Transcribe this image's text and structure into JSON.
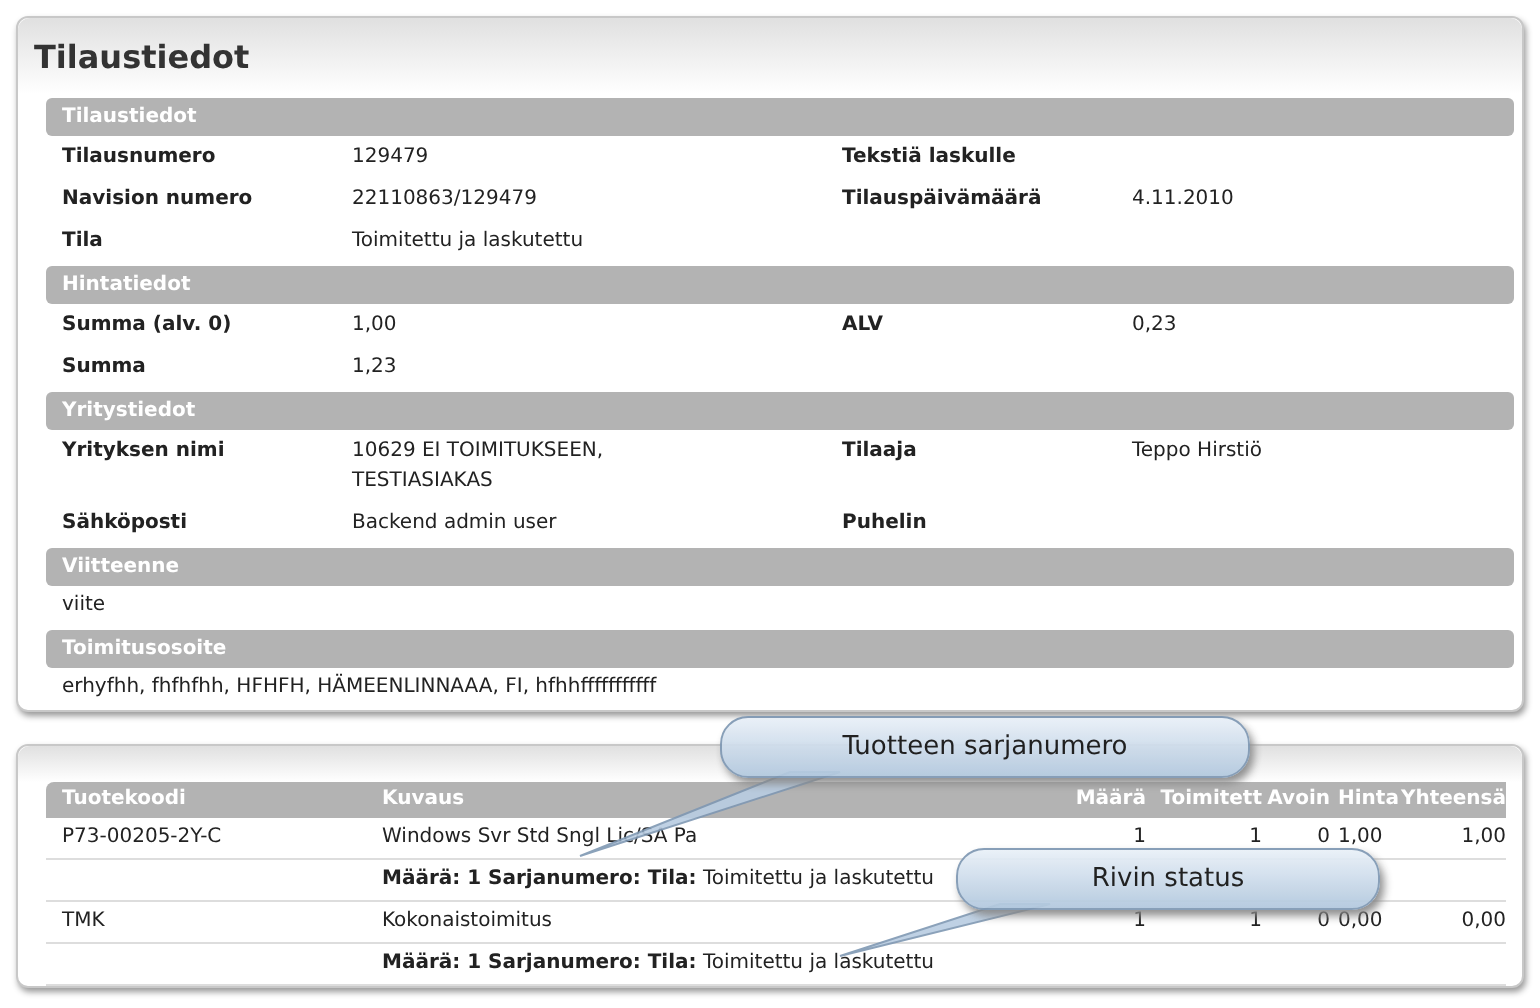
{
  "page_title": "Tilaustiedot",
  "sections": [
    {
      "title": "Tilaustiedot",
      "kind": "fields",
      "rows": [
        [
          {
            "label": "Tilausnumero",
            "value": "129479"
          },
          {
            "label": "Tekstiä laskulle"
          }
        ],
        [
          {
            "label": "Navision numero",
            "value": "22110863/129479"
          },
          {
            "label": "Tilauspäivämäärä",
            "value": "4.11.2010"
          }
        ],
        [
          {
            "label": "Tila",
            "value": "Toimitettu ja laskutettu"
          }
        ]
      ]
    },
    {
      "title": "Hintatiedot",
      "kind": "fields",
      "rows": [
        [
          {
            "label": "Summa (alv. 0)",
            "value": "1,00"
          },
          {
            "label": "ALV",
            "value": "0,23"
          }
        ],
        [
          {
            "label": "Summa",
            "value": "1,23"
          }
        ]
      ]
    },
    {
      "title": "Yritystiedot",
      "kind": "fields",
      "rows": [
        [
          {
            "label": "Yrityksen nimi",
            "value": "10629 EI TOIMITUKSEEN, TESTIASIAKAS"
          },
          {
            "label": "Tilaaja",
            "value": "Teppo Hirstiö"
          }
        ],
        [
          {
            "label": "Sähköposti",
            "value": "Backend admin user"
          },
          {
            "label": "Puhelin"
          }
        ]
      ]
    },
    {
      "title": "Viitteenne",
      "kind": "text",
      "text": "viite"
    },
    {
      "title": "Toimitusosoite",
      "kind": "text",
      "text": "erhyfhh, fhfhfhh, HFHFH, HÄMEENLINNAAA, FI, hfhhfffffffffff"
    }
  ],
  "order_lines": {
    "columns": [
      "Tuotekoodi",
      "Kuvaus",
      "Määrä",
      "Toimitett",
      "Avoin",
      "Hinta",
      "Yhteensä"
    ],
    "rows": [
      {
        "cells": [
          "P73-00205-2Y-C",
          "Windows Svr Std Sngl Lic/SA Pa",
          "1",
          "1",
          "0",
          "1,00",
          "1,00"
        ],
        "detail": "**Määrä: 1 Sarjanumero: Tila:** Toimitettu ja laskutettu"
      },
      {
        "cells": [
          "TMK",
          "Kokonaistoimitus",
          "1",
          "1",
          "0",
          "0,00",
          "0,00"
        ],
        "detail": "**Määrä: 1 Sarjanumero: Tila:** Toimitettu ja laskutettu"
      }
    ]
  },
  "callouts": [
    {
      "text": "Tuotteen sarjanumero"
    },
    {
      "text": "Rivin status"
    }
  ]
}
